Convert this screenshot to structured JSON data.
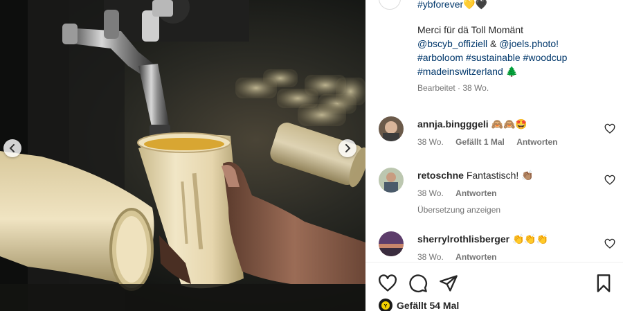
{
  "caption": {
    "line1": "#ybforever",
    "line1_emojis": "💛🖤",
    "line2": "Merci für dä Toll Momänt",
    "line3_mention1": "@bscyb_offiziell",
    "line3_amp": "&",
    "line3_mention2": "@joels.photo!",
    "line4": "#arboloom #sustainable #woodcup",
    "line5": "#madeinswitzerland",
    "line5_emoji": "🌲",
    "meta": "Bearbeitet · 38 Wo."
  },
  "comments": [
    {
      "user": "annja.bingggeli",
      "text": "🙈🙈🤩",
      "time": "38 Wo.",
      "likes": "Gefällt 1 Mal",
      "reply": "Antworten"
    },
    {
      "user": "retoschne",
      "text": "Fantastisch! 👏🏽",
      "time": "38 Wo.",
      "reply": "Antworten",
      "translate": "Übersetzung anzeigen"
    },
    {
      "user": "sherrylrothlisberger",
      "text": "👏👏👏",
      "time": "38 Wo.",
      "reply": "Antworten"
    }
  ],
  "likes_label": "Gefällt 54 Mal",
  "icons": {
    "like": "heart-icon",
    "comment": "comment-icon",
    "share": "paper-plane-icon",
    "save": "bookmark-icon",
    "prev": "chevron-left-icon",
    "next": "chevron-right-icon"
  },
  "colors": {
    "link": "#00376b",
    "meta": "#737373"
  }
}
